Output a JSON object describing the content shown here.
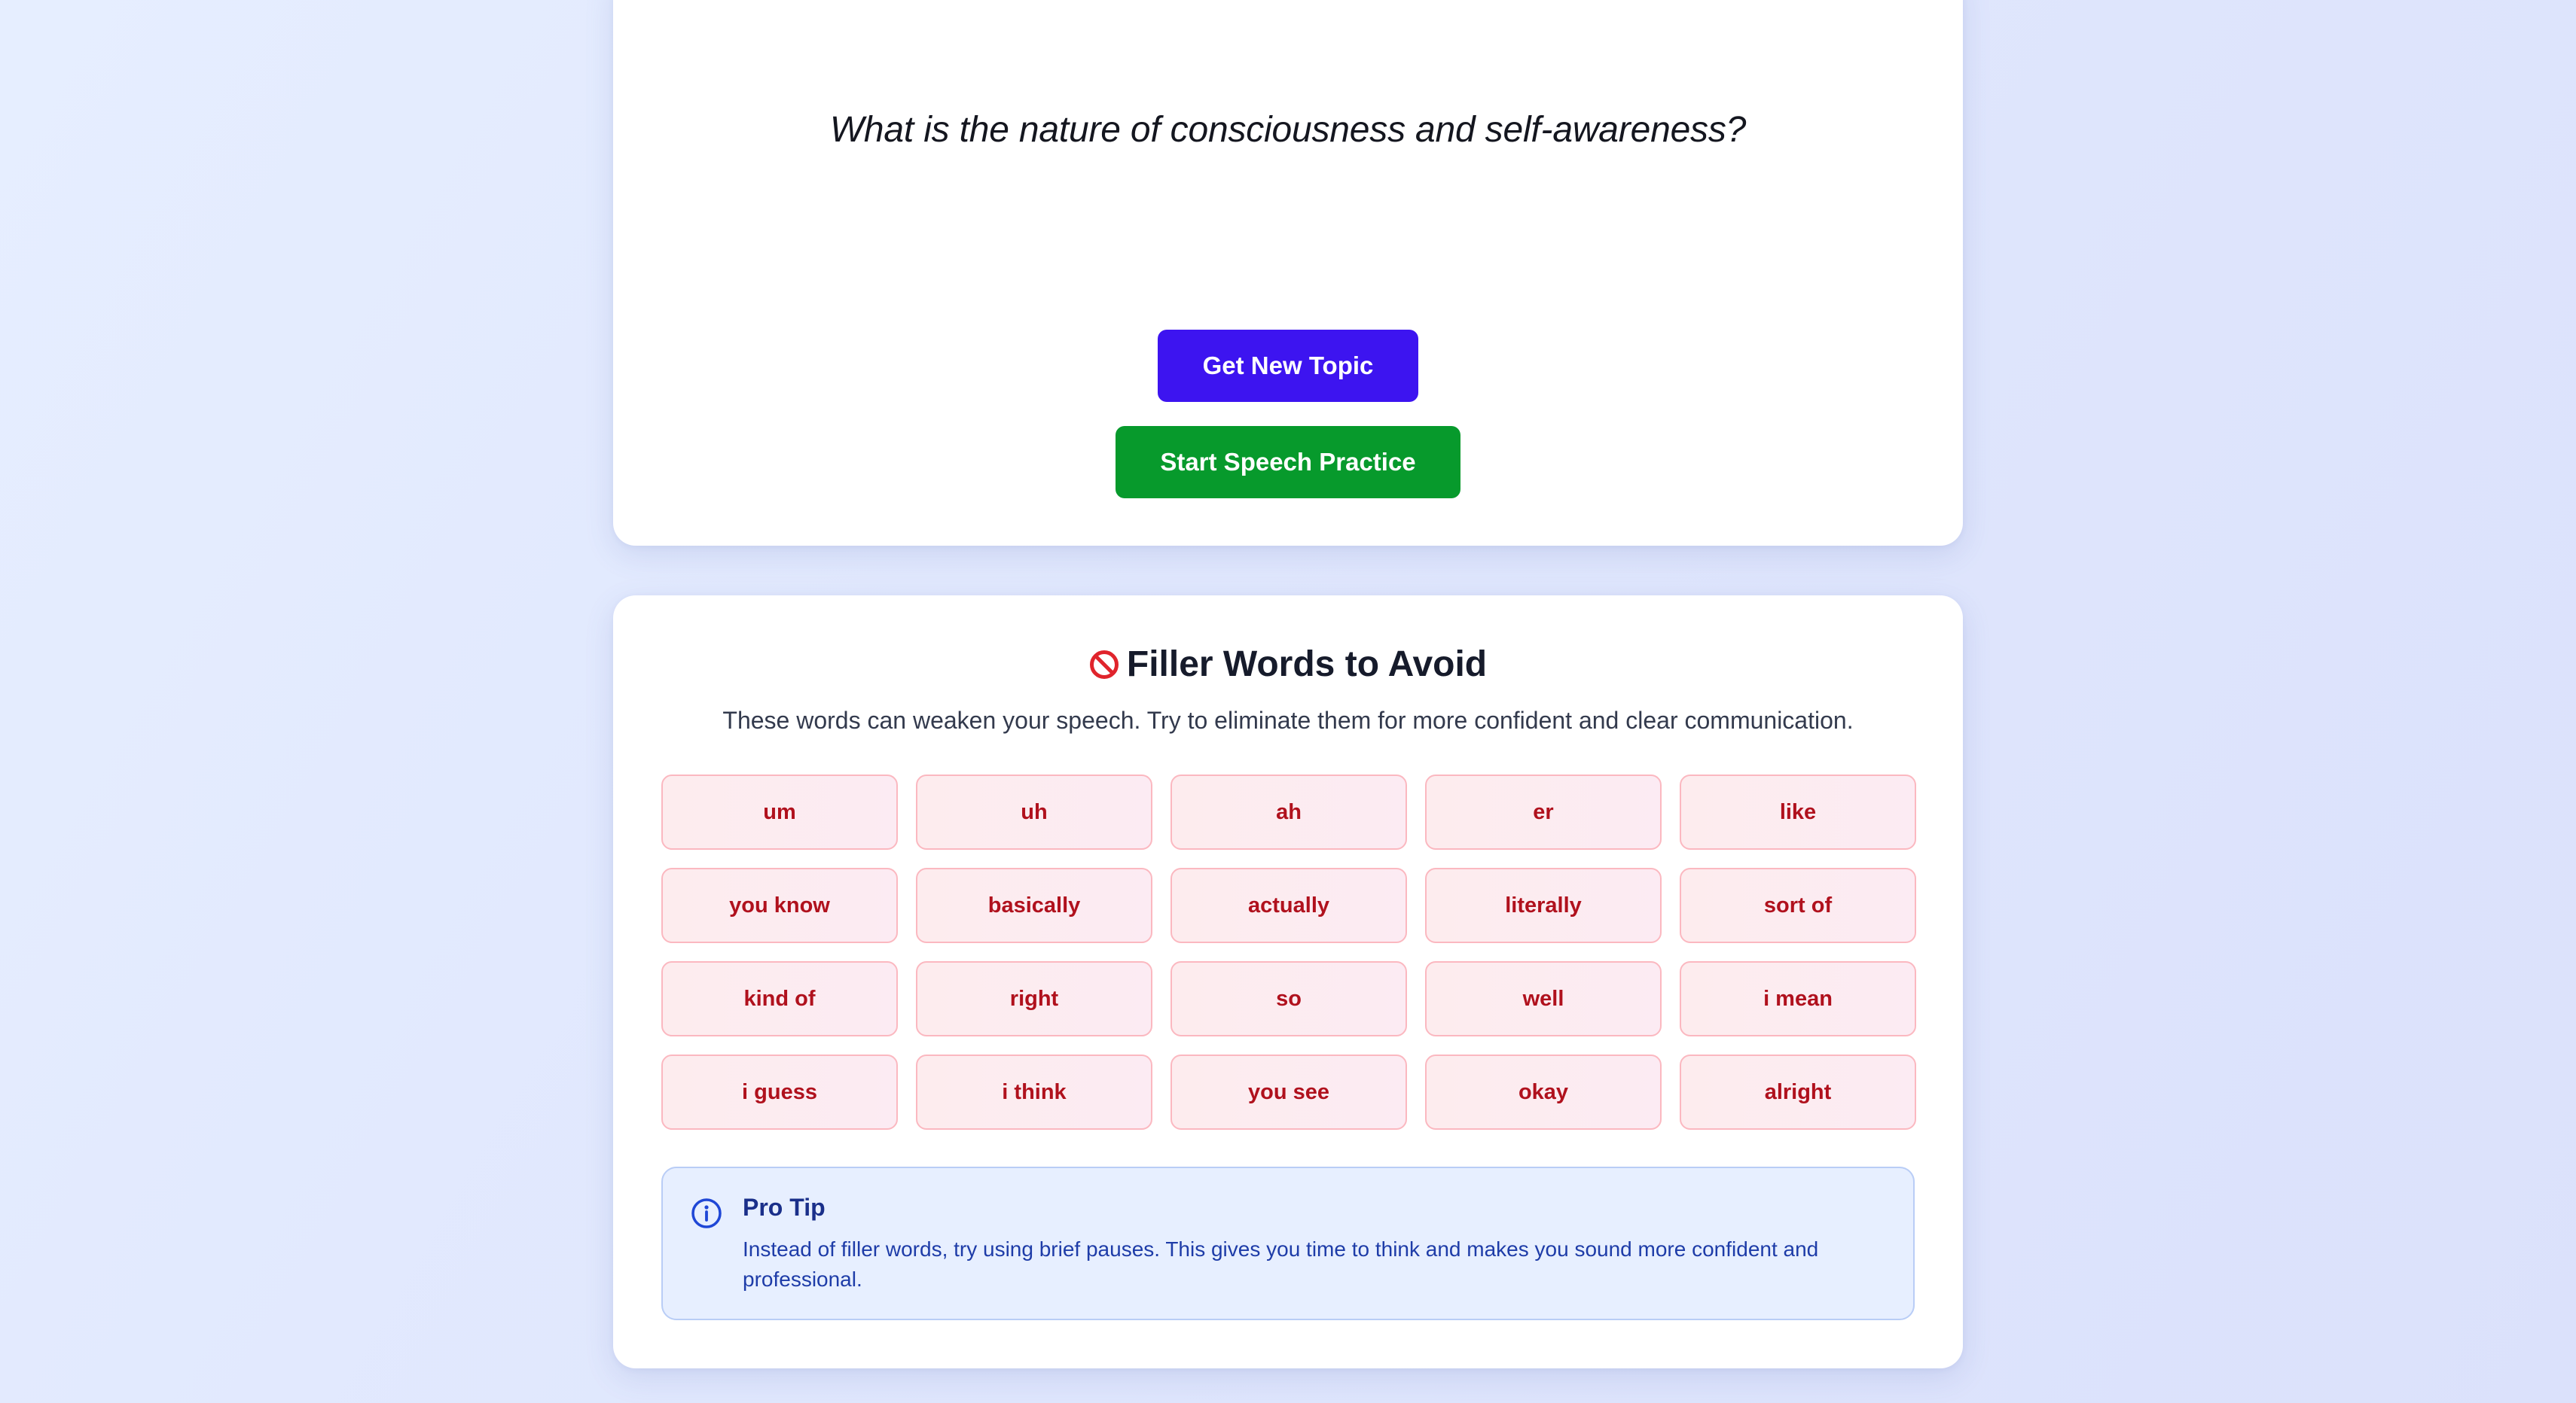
{
  "topic": {
    "question": "What is the nature of consciousness and self-awareness?",
    "new_topic_label": "Get New Topic",
    "start_practice_label": "Start Speech Practice"
  },
  "filler": {
    "title": "Filler Words to Avoid",
    "title_icon": "prohibited-icon",
    "subtitle": "These words can weaken your speech. Try to eliminate them for more confident and clear communication.",
    "words": [
      "um",
      "uh",
      "ah",
      "er",
      "like",
      "you know",
      "basically",
      "actually",
      "literally",
      "sort of",
      "kind of",
      "right",
      "so",
      "well",
      "i mean",
      "i guess",
      "i think",
      "you see",
      "okay",
      "alright"
    ]
  },
  "tip": {
    "icon": "info-icon",
    "title": "Pro Tip",
    "text": "Instead of filler words, try using brief pauses. This gives you time to think and makes you sound more confident and professional."
  },
  "colors": {
    "new_topic_button": "#3d14f0",
    "start_practice_button": "#079a2c",
    "filler_word_text": "#b0111d",
    "filler_word_border": "#fbb8c0",
    "tip_background": "#e7efff",
    "tip_text": "#1e3ca8"
  }
}
